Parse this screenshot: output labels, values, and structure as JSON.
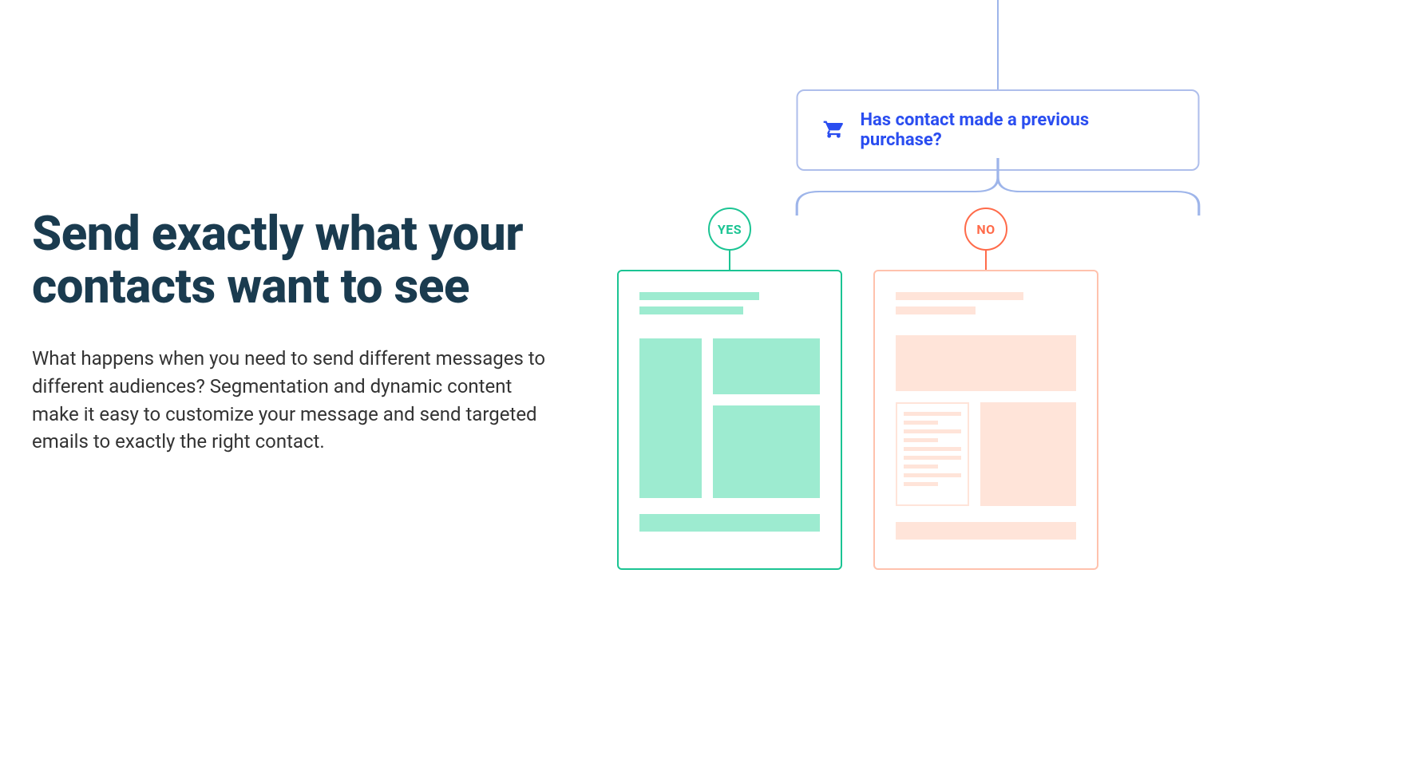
{
  "hero": {
    "heading": "Send exactly what your contacts want to see",
    "paragraph": "What happens when you need to send different messages to different audiences? Segmentation and dynamic content make it easy to customize your message and send targeted emails to exactly the right contact."
  },
  "diagram": {
    "condition_label": "Has contact made a previous purchase?",
    "branch_yes_label": "YES",
    "branch_no_label": "NO",
    "icons": {
      "condition": "cart-icon"
    },
    "colors": {
      "condition_border": "#aebeeb",
      "condition_text": "#2a4df0",
      "yes": "#1bc493",
      "no": "#ff6b4a",
      "yes_fill": "#9debd0",
      "no_fill": "#ffe4d9"
    }
  }
}
